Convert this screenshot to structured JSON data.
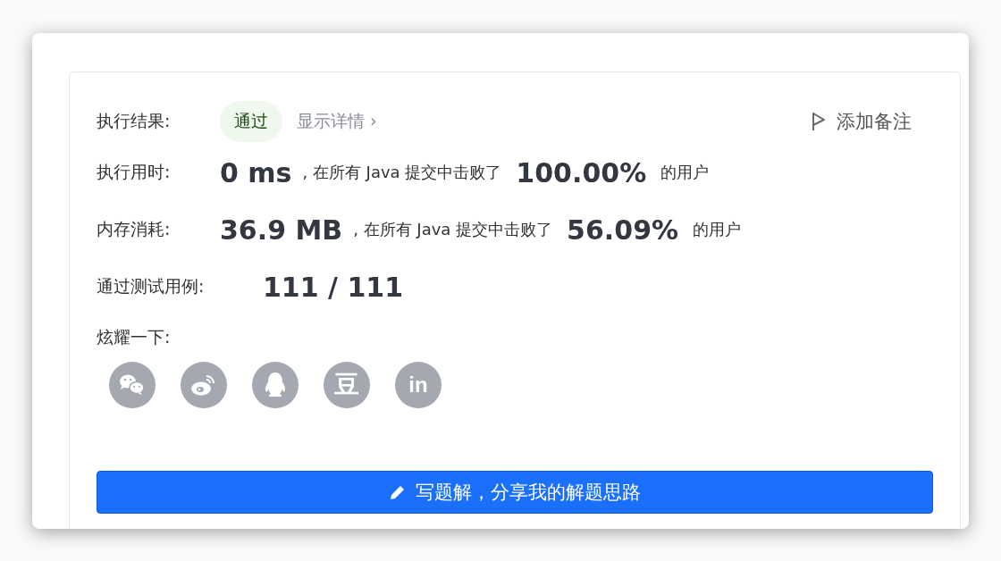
{
  "result": {
    "label": "执行结果:",
    "status": "通过",
    "passed": true,
    "details_link": "显示详情 ›",
    "note_button": "添加备注"
  },
  "stats": [
    {
      "label": "执行用时:",
      "value": "0 ms",
      "middle": ", 在所有 Java 提交中击败了",
      "percent": "100.00%",
      "suffix": "的用户"
    },
    {
      "label": "内存消耗:",
      "value": "36.9 MB",
      "middle": ", 在所有 Java 提交中击败了",
      "percent": "56.09%",
      "suffix": "的用户"
    }
  ],
  "tests": {
    "label": "通过测试用例:",
    "value": "111 / 111"
  },
  "share": {
    "label": "炫耀一下:",
    "items": [
      {
        "kind": "wechat"
      },
      {
        "kind": "weibo"
      },
      {
        "kind": "qq"
      },
      {
        "kind": "douban",
        "glyph": "豆"
      },
      {
        "kind": "linkedin",
        "glyph": "in"
      }
    ]
  },
  "write_button": "写题解，分享我的解题思路"
}
